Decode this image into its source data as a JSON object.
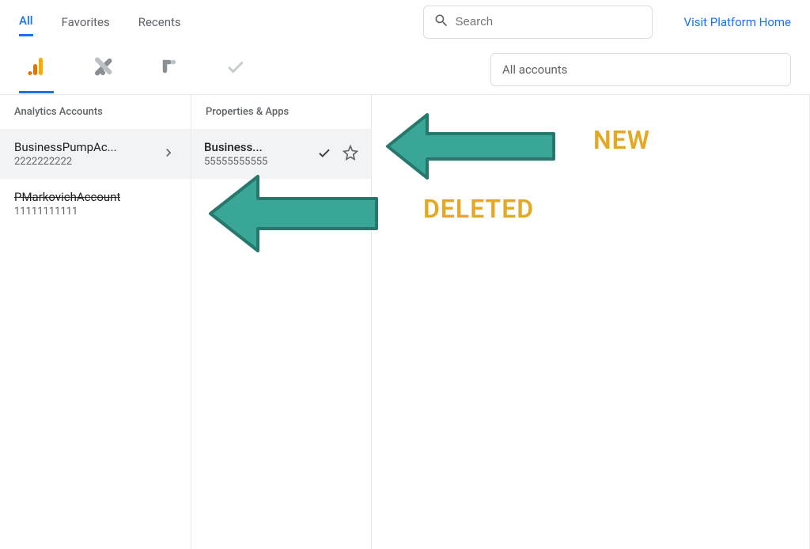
{
  "header": {
    "tabs": {
      "all": "All",
      "favorites": "Favorites",
      "recents": "Recents"
    },
    "search_placeholder": "Search",
    "platform_link": "Visit Platform Home"
  },
  "products": {
    "analytics": "analytics",
    "tagmanager": "tagmanager",
    "optimize": "optimize",
    "surveys": "surveys",
    "all_accounts": "All accounts"
  },
  "columns": {
    "accounts_header": "Analytics Accounts",
    "props_header": "Properties & Apps"
  },
  "accounts": [
    {
      "name": "BusinessPumpAc...",
      "id": "2222222222",
      "selected": true,
      "strike": false
    },
    {
      "name": "PMarkovichAccount",
      "id": "11111111111",
      "selected": false,
      "strike": true
    }
  ],
  "properties": [
    {
      "name": "Business...",
      "id": "55555555555",
      "checked": true,
      "starred": false,
      "selected": true
    }
  ],
  "annotations": {
    "new": "NEW",
    "deleted": "DELETED"
  },
  "colors": {
    "accent": "#1a73e8",
    "arrow": "#3aa698",
    "arrow_edge": "#26786d",
    "label": "#e3a922"
  }
}
